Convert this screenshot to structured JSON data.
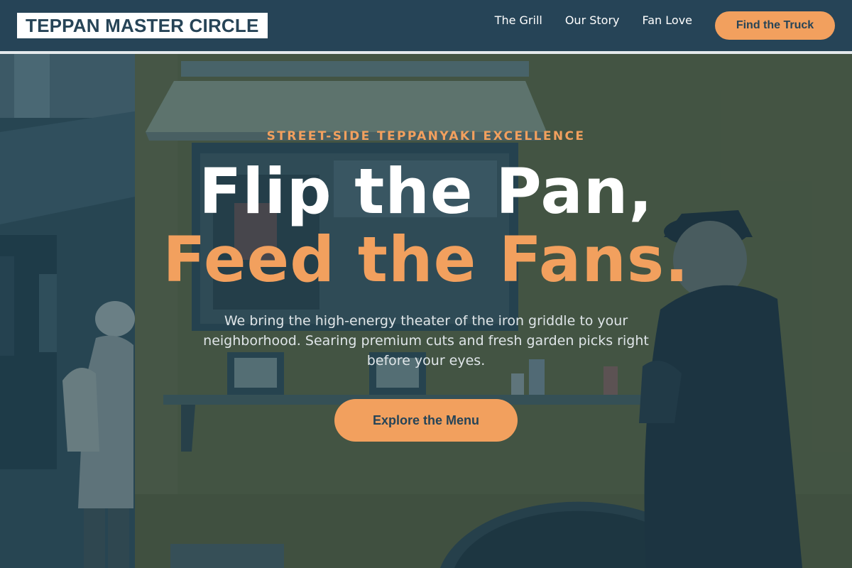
{
  "brand": {
    "name": "TEPPAN MASTER CIRCLE"
  },
  "nav": {
    "links": [
      "The Grill",
      "Our Story",
      "Fan Love"
    ],
    "cta_label": "Find the Truck"
  },
  "hero": {
    "eyebrow": "STREET-SIDE TEPPANYAKI EXCELLENCE",
    "headline_line1": "Flip the Pan,",
    "headline_line2": "Feed the Fans.",
    "description": "We bring the high-energy theater of the iron griddle to your neighborhood. Searing premium cuts and fresh garden picks right before your eyes.",
    "button_label": "Explore the Menu"
  },
  "colors": {
    "navy": "#264457",
    "accent": "#f2a05e",
    "header_rule": "#e4e9ec",
    "body_text": "#dfe5e8"
  },
  "icons": {
    "background": "food-truck-photo"
  }
}
